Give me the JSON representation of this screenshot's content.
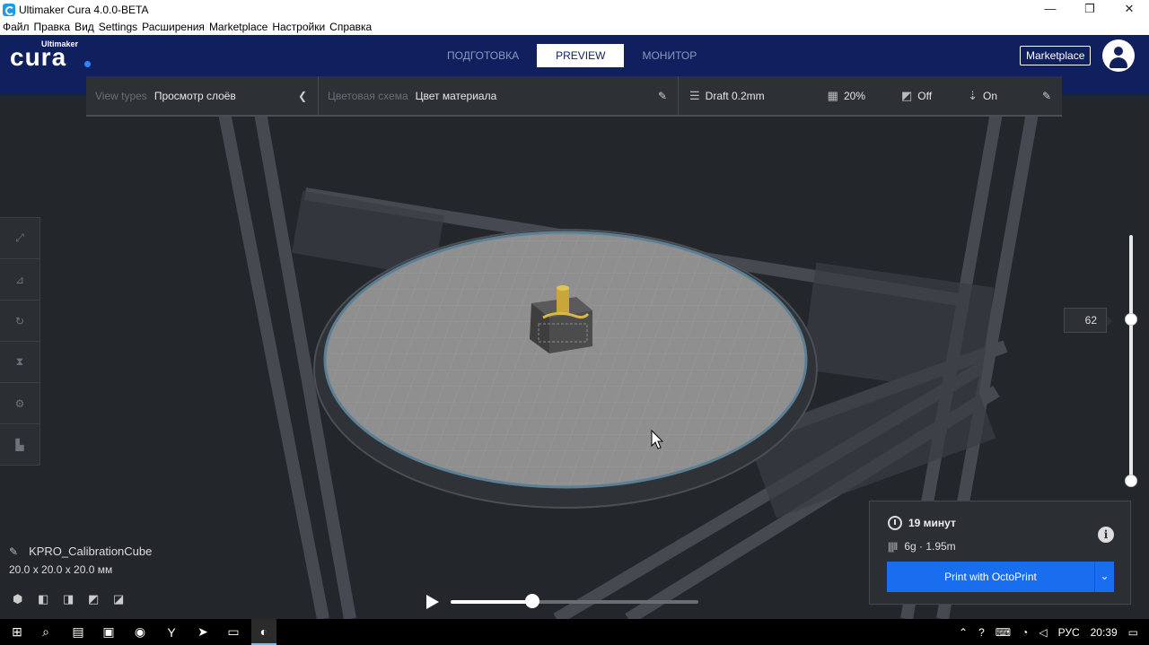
{
  "window": {
    "title": "Ultimaker Cura 4.0.0-BETA",
    "controls": [
      "—",
      "❐",
      "✕"
    ]
  },
  "menu": [
    "Файл",
    "Правка",
    "Вид",
    "Settings",
    "Расширения",
    "Marketplace",
    "Настройки",
    "Справка"
  ],
  "header": {
    "logo_small": "Ultimaker",
    "logo": "cura",
    "tabs": [
      "ПОДГОТОВКА",
      "PREVIEW",
      "МОНИТОР"
    ],
    "active_tab": "PREVIEW",
    "marketplace_label": "Marketplace"
  },
  "view_toolbar": {
    "view_types_label": "View types",
    "view_types_value": "Просмотр слоёв",
    "color_scheme_label": "Цветовая схема",
    "color_scheme_value": "Цвет материала",
    "profile": "Draft 0.2mm",
    "infill": "20%",
    "support": "Off",
    "adhesion": "On"
  },
  "layer_slider": {
    "value": "62"
  },
  "object": {
    "name": "KPRO_CalibrationCube",
    "dimensions": "20.0 x 20.0 x 20.0 мм"
  },
  "simulation": {
    "progress": 0.33
  },
  "print_panel": {
    "time": "19 минут",
    "material": "6g · 1.95m",
    "print_button": "Print with OctoPrint"
  },
  "taskbar": {
    "language": "РУС",
    "time": "20:39"
  },
  "colors": {
    "header_bg": "#10205e",
    "accent": "#196ef0",
    "viewport_bg": "#23262b"
  }
}
